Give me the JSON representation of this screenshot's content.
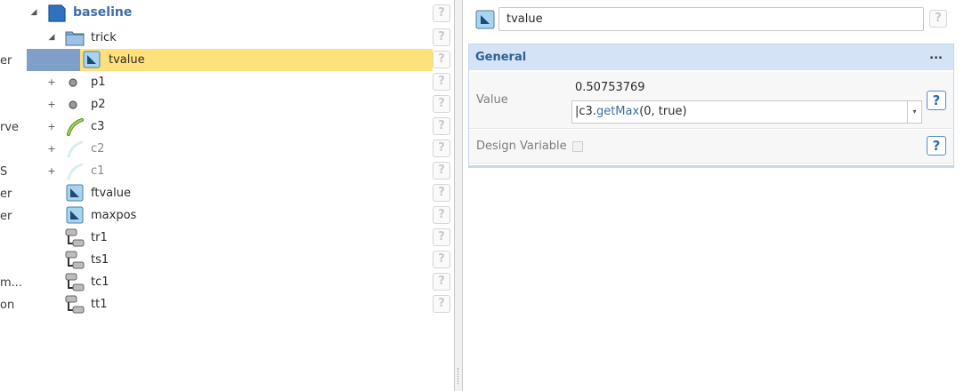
{
  "side_labels": [
    "er",
    "rve",
    "S",
    "er",
    "er",
    "m...",
    "on"
  ],
  "tree": {
    "root": {
      "label": "baseline"
    },
    "trick": {
      "label": "trick"
    },
    "selected": {
      "label": "tvalue"
    },
    "items": [
      {
        "label": "p1",
        "icon": "point-icon"
      },
      {
        "label": "p2",
        "icon": "point-icon"
      },
      {
        "label": "c3",
        "icon": "curve-icon"
      },
      {
        "label": "c2",
        "icon": "curve-faded-icon"
      },
      {
        "label": "c1",
        "icon": "curve-faded-icon"
      },
      {
        "label": "ftvalue",
        "icon": "parameter-icon"
      },
      {
        "label": "maxpos",
        "icon": "parameter-icon"
      },
      {
        "label": "tr1",
        "icon": "relation-icon"
      },
      {
        "label": "ts1",
        "icon": "relation-icon"
      },
      {
        "label": "tc1",
        "icon": "relation-icon"
      },
      {
        "label": "tt1",
        "icon": "relation-icon"
      }
    ],
    "help_glyph": "?"
  },
  "properties": {
    "name_value": "tvalue",
    "help_glyph": "?",
    "group_title": "General",
    "group_more": "...",
    "value_label": "Value",
    "value_result": "0.50753769",
    "expression": {
      "cursor": "|",
      "object": "c3",
      "dot": ".",
      "function": "getMax",
      "args": "(0, true)"
    },
    "design_variable_label": "Design Variable"
  },
  "colors": {
    "accent": "#3d6ea8",
    "selection": "#ffe07a",
    "group_header": "#d4e3f5"
  }
}
